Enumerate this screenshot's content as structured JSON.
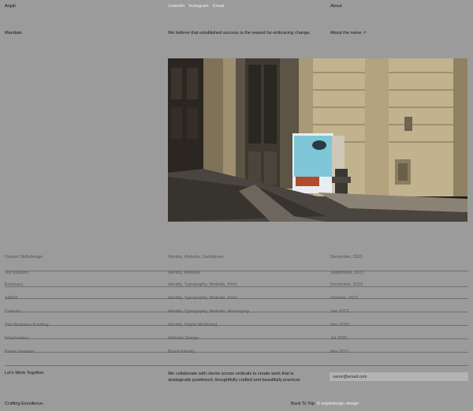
{
  "header": {
    "brand": "Anjali",
    "nav_links": [
      "LinkedIn",
      "Instagram",
      "Email"
    ],
    "about_link": "About"
  },
  "mandate": {
    "label": "Mandate",
    "statement": "We believe that established success is the reward for embracing change.",
    "about_name": "About the name ↗"
  },
  "projects": [
    {
      "name": "Distant Skillsdesign",
      "services": "Identity, Website, Guidelines",
      "date": "December, 2022"
    },
    {
      "name": "Joy Kosahin",
      "services": "Identity, Website",
      "date": "September, 2023"
    },
    {
      "name": "Emissary",
      "services": "Identity, Typography, Website, Print",
      "date": "December, 2023"
    },
    {
      "name": "SAKM",
      "services": "Identity, Typography, Website, Print",
      "date": "October, 2023"
    },
    {
      "name": "Carbury",
      "services": "Identity, Typography, Website, Messaging",
      "date": "Jan 2023"
    },
    {
      "name": "The Business Funding",
      "services": "Identity, Digital Marketing",
      "date": "Nov 2020"
    },
    {
      "name": "bokefunderz",
      "services": "Website Design",
      "date": "Jul 2020"
    },
    {
      "name": "Primo Geniosis",
      "services": "Brand Identity",
      "date": "Mar 2021"
    }
  ],
  "contact": {
    "heading": "Let's Work Together.",
    "text": "We collaborate with clients across verticals to create work that is strategically positioned, thoughtfully crafted and beautifully practical.",
    "email_placeholder": "name@email.com"
  },
  "footer": {
    "tagline": "Crafting Excellence.",
    "back_to_top": "Back To Top",
    "credit": "© anjalidesign design"
  },
  "colors": {
    "background": "#9b9b9b",
    "divider": "#6f6f6f",
    "link": "#f2f2f2"
  }
}
